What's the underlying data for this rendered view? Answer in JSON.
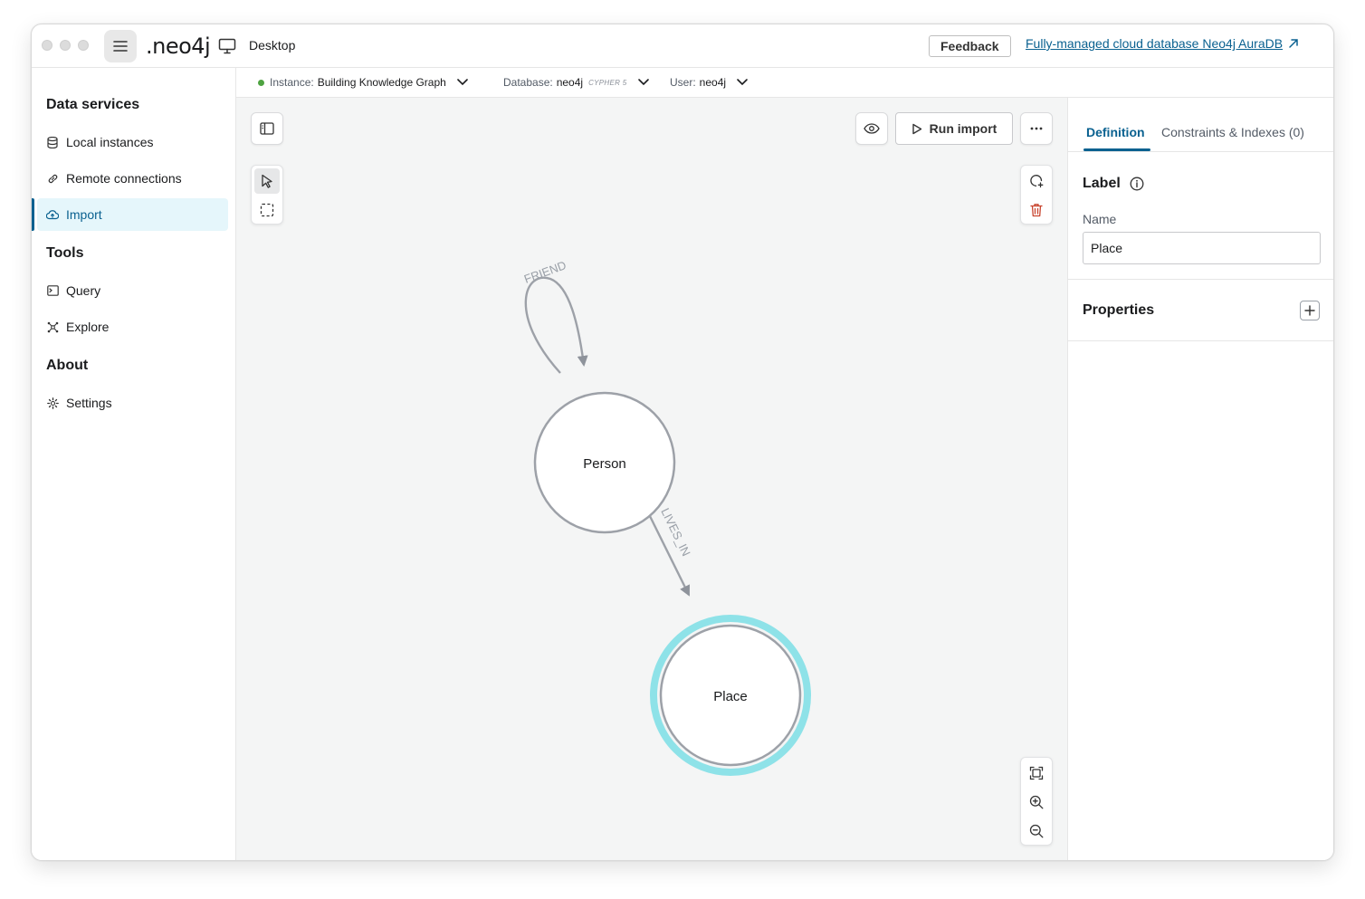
{
  "titlebar": {
    "logo": ".neo4j",
    "product": "Desktop",
    "feedback_label": "Feedback",
    "aura_link": "Fully-managed cloud database Neo4j AuraDB"
  },
  "sidebar": {
    "data_services_title": "Data services",
    "tools_title": "Tools",
    "about_title": "About",
    "items": [
      {
        "label": "Local instances",
        "icon": "database-icon"
      },
      {
        "label": "Remote connections",
        "icon": "link-icon"
      },
      {
        "label": "Import",
        "icon": "cloud-upload-icon",
        "active": true
      },
      {
        "label": "Query",
        "icon": "terminal-icon"
      },
      {
        "label": "Explore",
        "icon": "graph-explore-icon"
      },
      {
        "label": "Settings",
        "icon": "gear-icon"
      }
    ]
  },
  "connection": {
    "instance_label": "Instance:",
    "instance_value": "Building Knowledge Graph",
    "database_label": "Database:",
    "database_value": "neo4j",
    "cypher_tag": "CYPHER 5",
    "user_label": "User:",
    "user_value": "neo4j",
    "status_color": "#4ea341"
  },
  "canvas": {
    "run_import_label": "Run import",
    "nodes": [
      {
        "id": "person",
        "label": "Person",
        "selected": false
      },
      {
        "id": "place",
        "label": "Place",
        "selected": true
      }
    ],
    "relationships": [
      {
        "type": "FRIEND",
        "from": "person",
        "to": "person"
      },
      {
        "type": "LIVES_IN",
        "from": "person",
        "to": "place"
      }
    ],
    "selection_color": "#8ee2e8"
  },
  "panel": {
    "tab_definition": "Definition",
    "tab_constraints": "Constraints & Indexes (0)",
    "label_heading": "Label",
    "name_label": "Name",
    "name_value": "Place",
    "properties_heading": "Properties"
  },
  "colors": {
    "accent": "#0a6190",
    "active_bg": "#e5f6fb",
    "delete": "#c8432d"
  }
}
